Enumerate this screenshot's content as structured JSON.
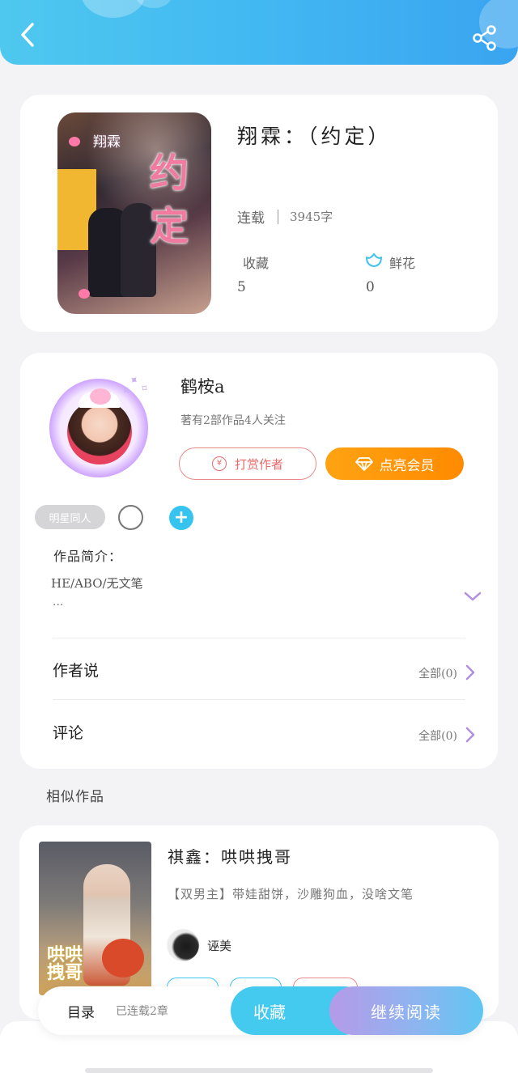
{
  "colors": {
    "accent": "#44c9ef",
    "vip": "#ff9a0a",
    "reward": "#e46a6a"
  },
  "header": {
    "back_icon": "back-arrow-icon",
    "share_icon": "share-icon"
  },
  "book": {
    "title": "翔霖：（约定）",
    "status": "连载",
    "word_count": "3945字",
    "cover_text_large": "约定",
    "cover_text_small": "翔霖",
    "favorites_label": "收藏",
    "favorites_count": "5",
    "flowers_label": "鲜花",
    "flowers_count": "0"
  },
  "author": {
    "name": "鹤桉a",
    "stats": "著有2部作品4人关注",
    "reward_label": "打赏作者",
    "vip_label": "点亮会员",
    "tag": "明星同人",
    "add_icon": "+"
  },
  "intro": {
    "label": "作品简介：",
    "text": "HE/ABO/无文笔",
    "more": "..."
  },
  "author_says": {
    "label": "作者说",
    "link": "全部(0)"
  },
  "comments": {
    "label": "评论",
    "link": "全部(0)"
  },
  "similar": {
    "section_title": "相似作品",
    "items": [
      {
        "title": "祺鑫：哄哄拽哥",
        "desc": "【双男主】带娃甜饼，沙雕狗血，没啥文笔",
        "author": "诬美",
        "cover_text": "哄哄拽哥"
      }
    ]
  },
  "bottom_bar": {
    "toc_label": "目录",
    "chapters": "已连载2章",
    "favorite_label": "收藏",
    "read_label": "继续阅读"
  }
}
